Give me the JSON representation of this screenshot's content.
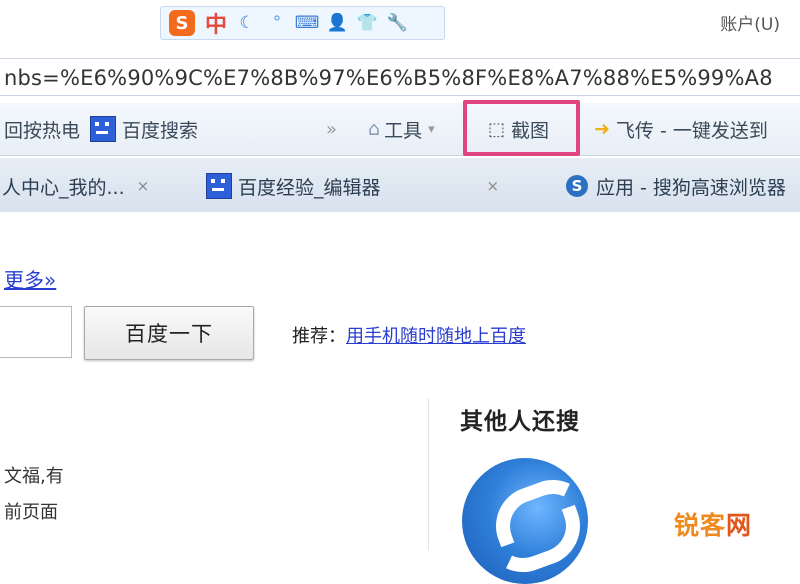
{
  "ime": {
    "logo": "S",
    "mode": "中",
    "icons": [
      "moon-icon",
      "dot-icon",
      "keyboard-icon",
      "user-icon",
      "shirt-icon",
      "wrench-icon"
    ]
  },
  "header": {
    "account": "账户(U)"
  },
  "address": {
    "url": "nbs=%E6%90%9C%E7%8B%97%E6%B5%8F%E8%A7%88%E5%99%A8"
  },
  "toolbar": {
    "item1": "回按热电",
    "baidu_search": "百度搜索",
    "overflow": "»",
    "tools": "工具",
    "screenshot": "截图",
    "feichuan": "飞传 - 一键发送到"
  },
  "tabs": [
    {
      "label": "人中心_我的...",
      "close": "×"
    },
    {
      "label": "百度经验_编辑器",
      "close": "×"
    },
    {
      "label": "应用 - 搜狗高速浏览器"
    }
  ],
  "page": {
    "more": "更多»",
    "search_button": "百度一下",
    "recommend_prefix": "推荐：",
    "recommend_link": "用手机随时随地上百度",
    "others_title": "其他人还搜",
    "snippet_line1": "文福,有",
    "snippet_line2": "前页面"
  },
  "watermark": {
    "part1": "锐客",
    "part2": "网"
  },
  "colors": {
    "highlight": "#e0457f",
    "link": "#2a3dd1",
    "watermark": "#f08a1f"
  }
}
